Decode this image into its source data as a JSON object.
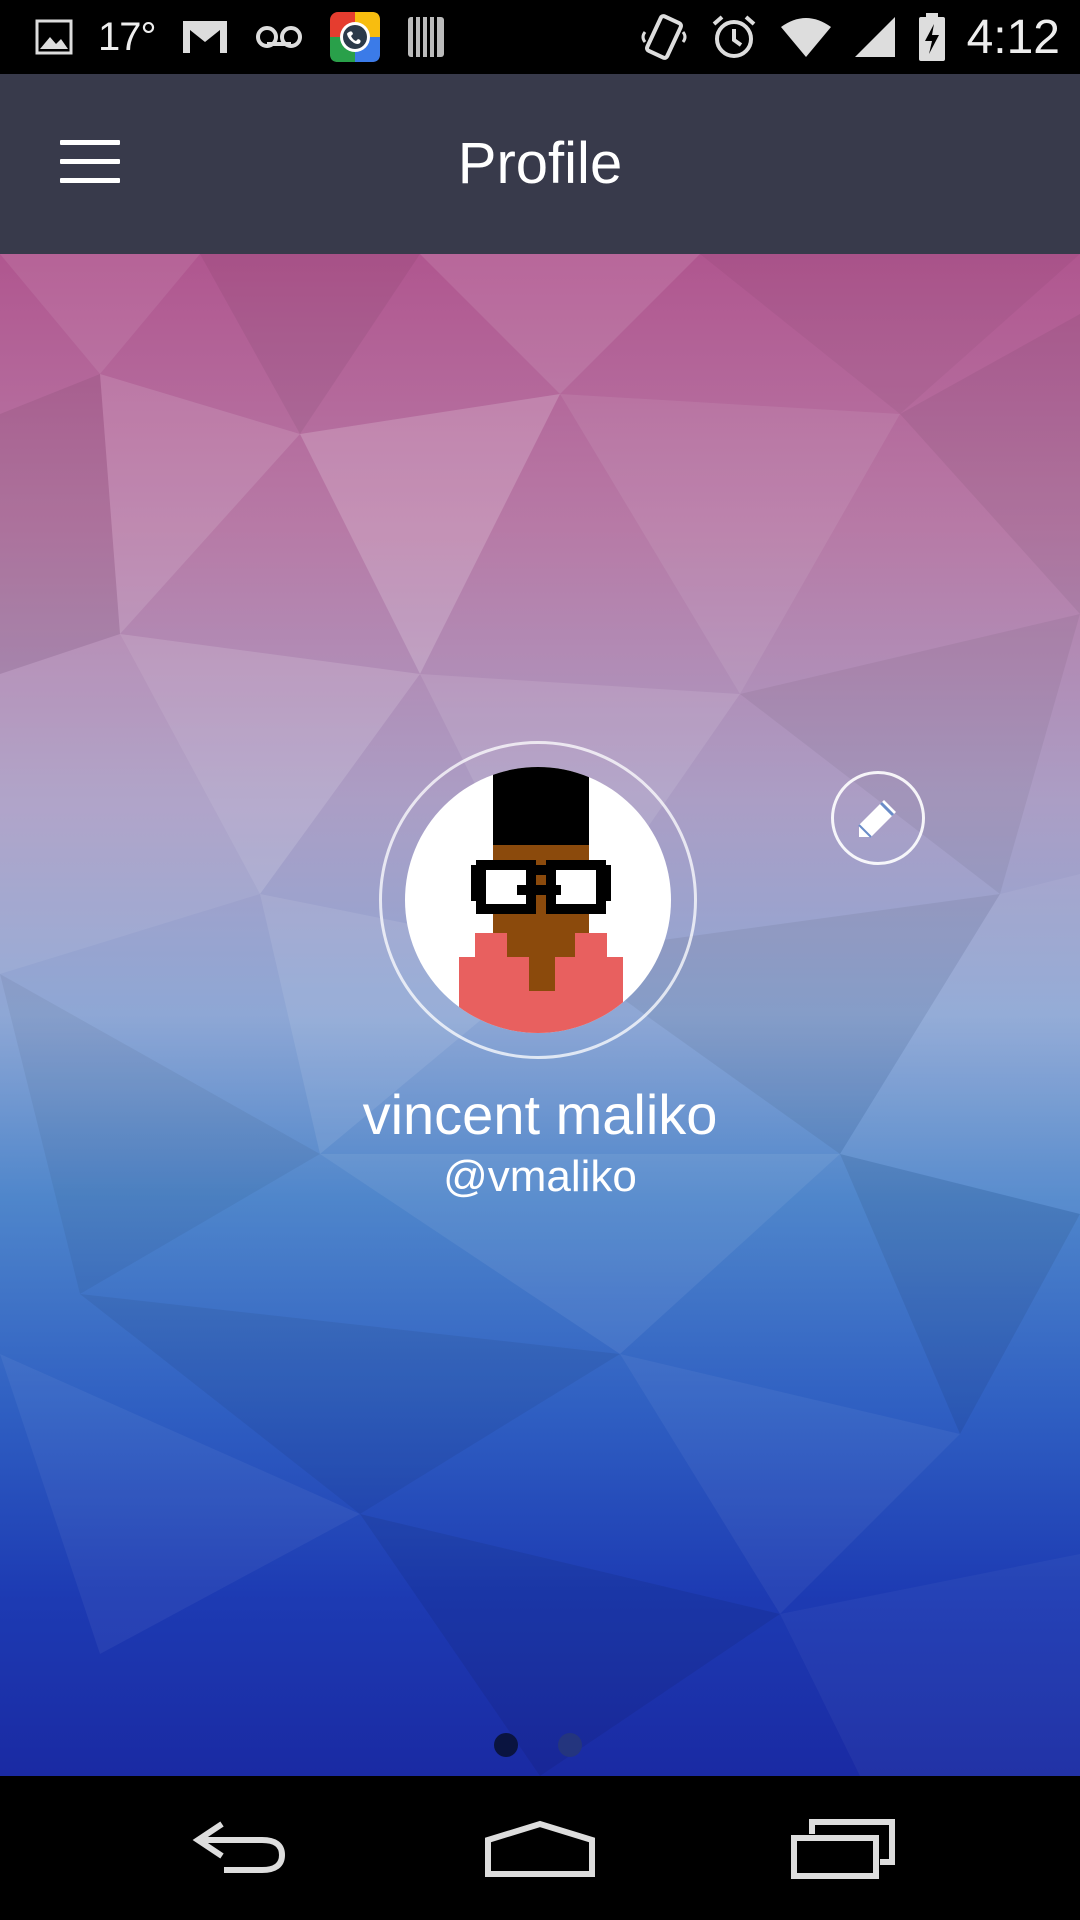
{
  "status_bar": {
    "temperature": "17°",
    "time": "4:12",
    "icons": [
      "image-icon",
      "gmail-icon",
      "voicemail-icon",
      "hangouts-icon",
      "barcode-icon",
      "vibrate-icon",
      "alarm-icon",
      "wifi-icon",
      "signal-icon",
      "battery-charging-icon"
    ]
  },
  "app_bar": {
    "title": "Profile",
    "menu_icon": "hamburger-menu-icon"
  },
  "profile": {
    "name": "vincent maliko",
    "handle": "@vmaliko",
    "edit_icon": "pencil-icon"
  },
  "pager": {
    "count": 2,
    "active_index": 0
  },
  "nav_bar": {
    "icons": [
      "back-icon",
      "home-icon",
      "recents-icon"
    ]
  },
  "colors": {
    "app_bar": "#383a4b",
    "status_bar": "#000000",
    "avatar_shirt": "#e8605f",
    "avatar_skin": "#8b4a0c"
  }
}
